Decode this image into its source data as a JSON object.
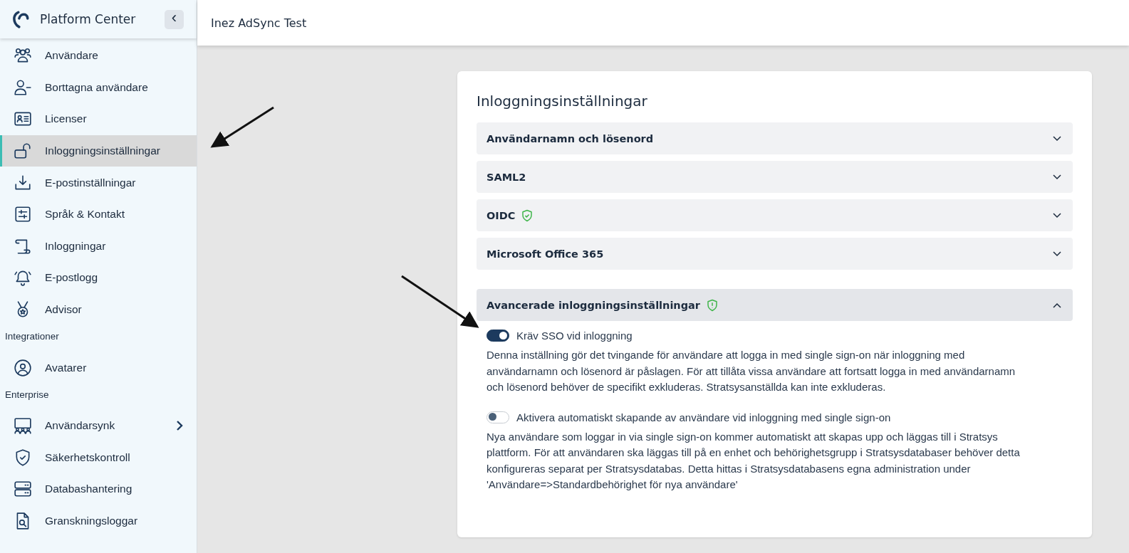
{
  "sidebar": {
    "title": "Platform Center",
    "collapse_button": "‹",
    "sections": [
      {
        "items": [
          {
            "label": "Användare",
            "selected": false,
            "expandable": false
          },
          {
            "label": "Borttagna användare",
            "selected": false,
            "expandable": false
          },
          {
            "label": "Licenser",
            "selected": false,
            "expandable": false
          },
          {
            "label": "Inloggningsinställningar",
            "selected": true,
            "expandable": false
          },
          {
            "label": "E-postinställningar",
            "selected": false,
            "expandable": false
          },
          {
            "label": "Språk & Kontakt",
            "selected": false,
            "expandable": false
          },
          {
            "label": "Inloggningar",
            "selected": false,
            "expandable": false
          },
          {
            "label": "E-postlogg",
            "selected": false,
            "expandable": false
          },
          {
            "label": "Advisor",
            "selected": false,
            "expandable": false
          }
        ]
      },
      {
        "heading": "Integrationer",
        "items": [
          {
            "label": "Avatarer",
            "selected": false,
            "expandable": false
          }
        ]
      },
      {
        "heading": "Enterprise",
        "items": [
          {
            "label": "Användarsynk",
            "selected": false,
            "expandable": true
          },
          {
            "label": "Säkerhetskontroll",
            "selected": false,
            "expandable": false
          },
          {
            "label": "Databashantering",
            "selected": false,
            "expandable": false
          },
          {
            "label": "Granskningsloggar",
            "selected": false,
            "expandable": false
          }
        ]
      }
    ]
  },
  "header": {
    "title": "Inez AdSync Test"
  },
  "card": {
    "title": "Inloggningsinställningar",
    "panels": [
      {
        "title": "Användarnamn och lösenord",
        "expanded": false
      },
      {
        "title": "SAML2",
        "expanded": false
      },
      {
        "title": "OIDC",
        "expanded": false,
        "kind": "verified"
      },
      {
        "title": "Microsoft Office 365",
        "expanded": false
      },
      {
        "title": "Avancerade inloggningsinställningar",
        "expanded": true,
        "kind": "warning",
        "settings": [
          {
            "label": "Kräv SSO vid inloggning",
            "on": true,
            "description": "Denna inställning gör det tvingande för användare att logga in med single sign-on när inloggning med användarnamn och lösenord är påslagen. För att tillåta vissa användare att fortsatt logga in med användarnamn och lösenord behöver de specifikt exkluderas. Stratsysanställda kan inte exkluderas."
          },
          {
            "label": "Aktivera automatiskt skapande av användare vid inloggning med single sign-on",
            "on": false,
            "description": "Nya användare som loggar in via single sign-on kommer automatiskt att skapas upp och läggas till i Stratsys plattform. För att användaren ska läggas till på en enhet och behörighetsgrupp i Stratsysdatabaser behöver detta konfigureras separat per Stratsysdatabas. Detta hittas i Stratsysdatabasens egna administration under 'Användare=>Standardbehörighet för nya användare'"
          }
        ]
      }
    ]
  }
}
